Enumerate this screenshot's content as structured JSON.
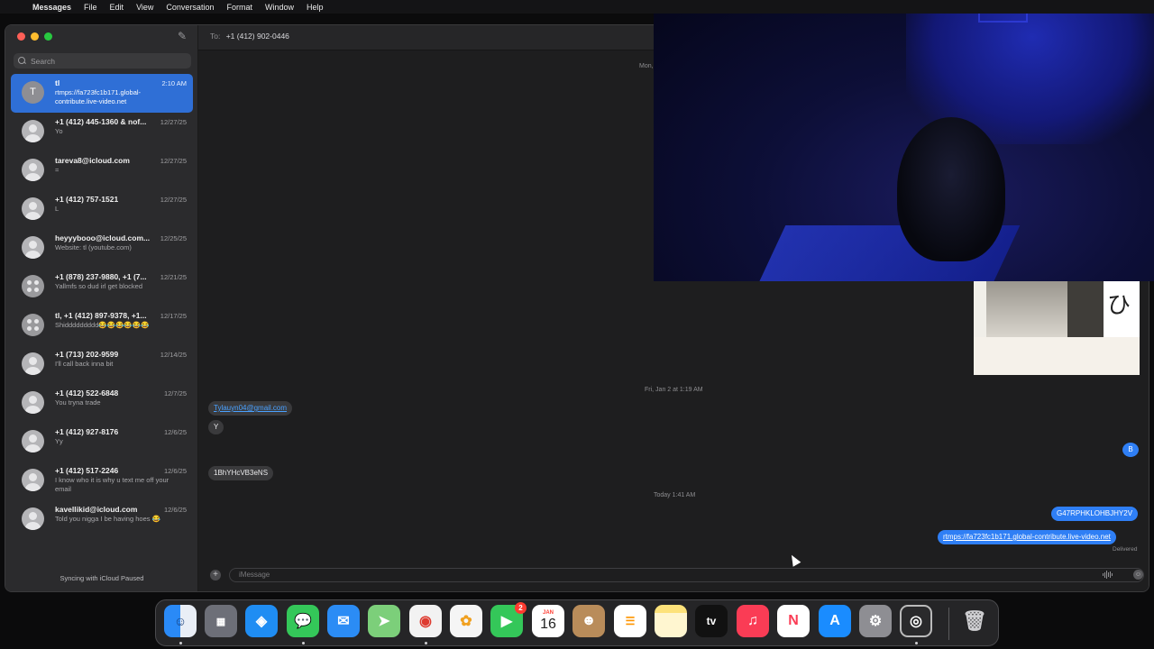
{
  "menubar": {
    "app_name": "Messages",
    "items": [
      "File",
      "Edit",
      "View",
      "Conversation",
      "Format",
      "Window",
      "Help"
    ]
  },
  "sidebar": {
    "search_placeholder": "Search",
    "sync_status": "Syncing with iCloud Paused",
    "conversations": [
      {
        "avatar": "T",
        "name": "tl",
        "date": "2:10 AM",
        "preview": "rtmps://fa723fc1b171.global-contribute.live-video.net",
        "active": true
      },
      {
        "avatar": "",
        "name": "+1 (412) 445-1360 & nof...",
        "date": "12/27/25",
        "preview": "Yo"
      },
      {
        "avatar": "",
        "name": "tareva8@icloud.com",
        "date": "12/27/25",
        "preview": "="
      },
      {
        "avatar": "",
        "name": "+1 (412) 757-1521",
        "date": "12/27/25",
        "preview": "L"
      },
      {
        "avatar": "",
        "name": "heyyybooo@icloud.com...",
        "date": "12/25/25",
        "preview": "Website: tl (youtube.com)"
      },
      {
        "avatar": "",
        "name": "+1 (878) 237-9880, +1 (7...",
        "date": "12/21/25",
        "preview": "Yallmfs so dud irl get blocked"
      },
      {
        "avatar": "",
        "name": "tl, +1 (412) 897-9378, +1...",
        "date": "12/17/25",
        "preview": "Shiddddddddd😂😂😂😂😂😂"
      },
      {
        "avatar": "",
        "name": "+1 (713) 202-9599",
        "date": "12/14/25",
        "preview": "I'll call back inna bit"
      },
      {
        "avatar": "",
        "name": "+1 (412) 522-6848",
        "date": "12/7/25",
        "preview": "You tryna trade"
      },
      {
        "avatar": "",
        "name": "+1 (412) 927-8176",
        "date": "12/6/25",
        "preview": "Yy"
      },
      {
        "avatar": "",
        "name": "+1 (412) 517-2246",
        "date": "12/6/25",
        "preview": "I know who it is why u text me off your email"
      },
      {
        "avatar": "",
        "name": "kavellikid@icloud.com",
        "date": "12/6/25",
        "preview": "Told you nigga I be having hoes 😂"
      }
    ]
  },
  "conversation": {
    "to_label": "To:",
    "recipient": "+1 (412) 902-0446",
    "timestamps": {
      "top": "Mon,",
      "mid": "Fri, Jan 2 at 1:19 AM",
      "today": "Today 1:41 AM"
    },
    "messages": {
      "in_email": "Tylauyn04@gmail.com",
      "in_y": "Y",
      "in_code": "1BhYHcVB3eNS",
      "out_b": "B",
      "out_code": "G47RPHKLOHBJHY2V",
      "out_link": "rtmps://fa723fc1b171.global-contribute.live-video.net"
    },
    "delivered": "Delivered",
    "input_placeholder": "iMessage"
  },
  "dock": {
    "calendar_month": "JAN",
    "calendar_day": "16",
    "facetime_badge": "2",
    "tv_label": "tv",
    "apps": [
      "finder",
      "launchpad",
      "safari",
      "messages",
      "mail",
      "maps",
      "chrome",
      "photos",
      "facetime",
      "calendar",
      "contacts",
      "reminders",
      "notes",
      "apple-tv",
      "music",
      "news",
      "app-store",
      "system-settings",
      "obs",
      "trash"
    ]
  }
}
